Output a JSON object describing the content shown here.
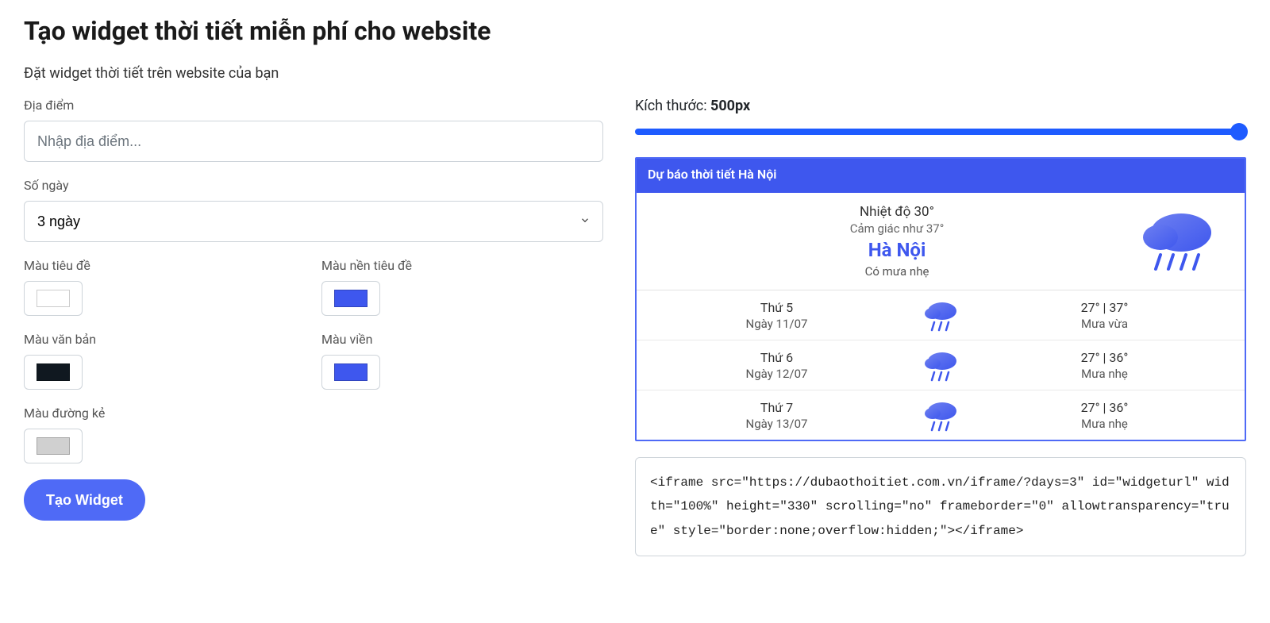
{
  "page": {
    "title": "Tạo widget thời tiết miễn phí cho website",
    "subtitle": "Đặt widget thời tiết trên website của bạn"
  },
  "form": {
    "location_label": "Địa điểm",
    "location_placeholder": "Nhập địa điểm...",
    "days_label": "Số ngày",
    "days_value": "3 ngày",
    "title_color_label": "Màu tiêu đề",
    "title_bg_label": "Màu nền tiêu đề",
    "text_color_label": "Màu văn bản",
    "border_color_label": "Màu viền",
    "line_color_label": "Màu đường kẻ",
    "swatches": {
      "title_color": "#ffffff",
      "title_bg": "#3e57ee",
      "text_color": "#101820",
      "border_color": "#3e57ee",
      "line_color": "#d0d0d0"
    },
    "submit_label": "Tạo Widget"
  },
  "preview": {
    "size_label": "Kích thước: ",
    "size_value": "500px",
    "header": "Dự báo thời tiết Hà Nội",
    "current": {
      "temp_line": "Nhiệt độ 30°",
      "feels_line": "Cảm giác như 37°",
      "city": "Hà Nội",
      "condition": "Có mưa nhẹ"
    },
    "days": [
      {
        "dow": "Thứ 5",
        "date": "Ngày 11/07",
        "temps": "27° | 37°",
        "cond": "Mưa vừa"
      },
      {
        "dow": "Thứ 6",
        "date": "Ngày 12/07",
        "temps": "27° | 36°",
        "cond": "Mưa nhẹ"
      },
      {
        "dow": "Thứ 7",
        "date": "Ngày 13/07",
        "temps": "27° | 36°",
        "cond": "Mưa nhẹ"
      }
    ]
  },
  "code": "<iframe src=\"https://dubaothoitiet.com.vn/iframe/?days=3\" id=\"widgeturl\" width=\"100%\" height=\"330\" scrolling=\"no\" frameborder=\"0\" allowtransparency=\"true\" style=\"border:none;overflow:hidden;\"></iframe>"
}
